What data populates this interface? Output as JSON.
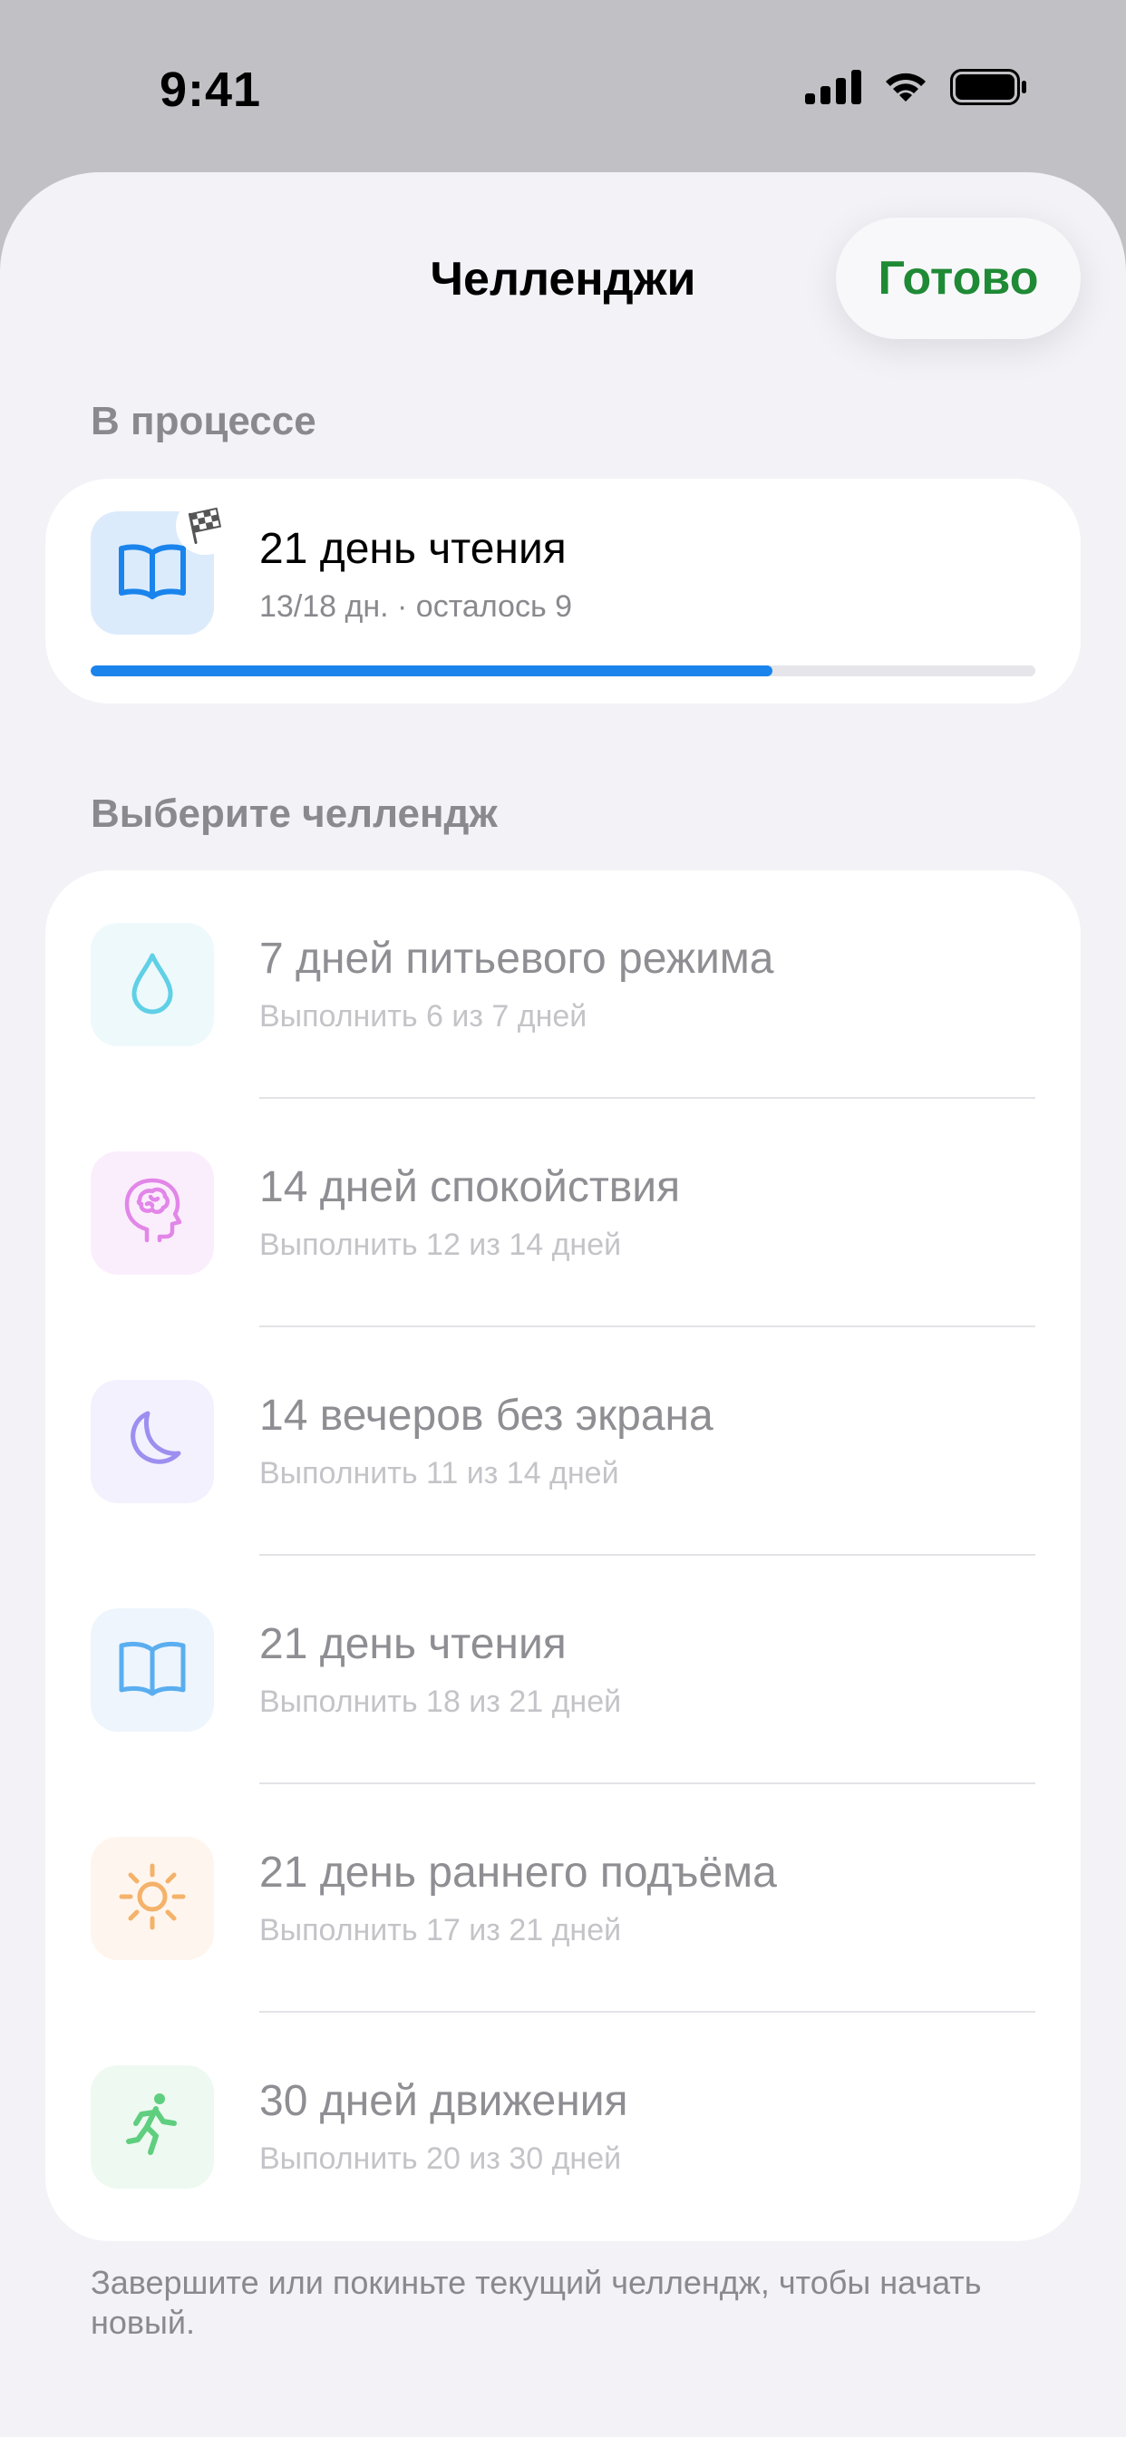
{
  "status_bar": {
    "time": "9:41"
  },
  "header": {
    "title": "Челленджи",
    "done_label": "Готово"
  },
  "in_progress": {
    "section_title": "В процессе",
    "challenge": {
      "title": "21 день чтения",
      "subtitle": "13/18 дн. · осталось 9",
      "progress_fraction": 0.722,
      "icon": "book-icon",
      "badge_icon": "checkered-flag-icon",
      "accent": "#1a84ec"
    }
  },
  "choose": {
    "section_title": "Выберите челлендж",
    "items": [
      {
        "title": "7 дней питьевого режима",
        "subtitle": "Выполнить 6 из 7 дней",
        "icon": "water-drop-icon",
        "color": "#5fd0e6"
      },
      {
        "title": "14 дней спокойствия",
        "subtitle": "Выполнить 12 из 14 дней",
        "icon": "brain-head-icon",
        "color": "#e286e8"
      },
      {
        "title": "14 вечеров без экрана",
        "subtitle": "Выполнить 11 из 14 дней",
        "icon": "moon-icon",
        "color": "#9c8ff0"
      },
      {
        "title": "21 день чтения",
        "subtitle": "Выполнить 18 из 21 дней",
        "icon": "book-icon",
        "color": "#5aaef0"
      },
      {
        "title": "21 день раннего подъёма",
        "subtitle": "Выполнить 17 из 21 дней",
        "icon": "sun-icon",
        "color": "#f4b26a"
      },
      {
        "title": "30 дней движения",
        "subtitle": "Выполнить 20 из 30 дней",
        "icon": "running-person-icon",
        "color": "#5fcf7f"
      }
    ]
  },
  "footer_note": "Завершите или покиньте текущий челлендж, чтобы начать новый."
}
